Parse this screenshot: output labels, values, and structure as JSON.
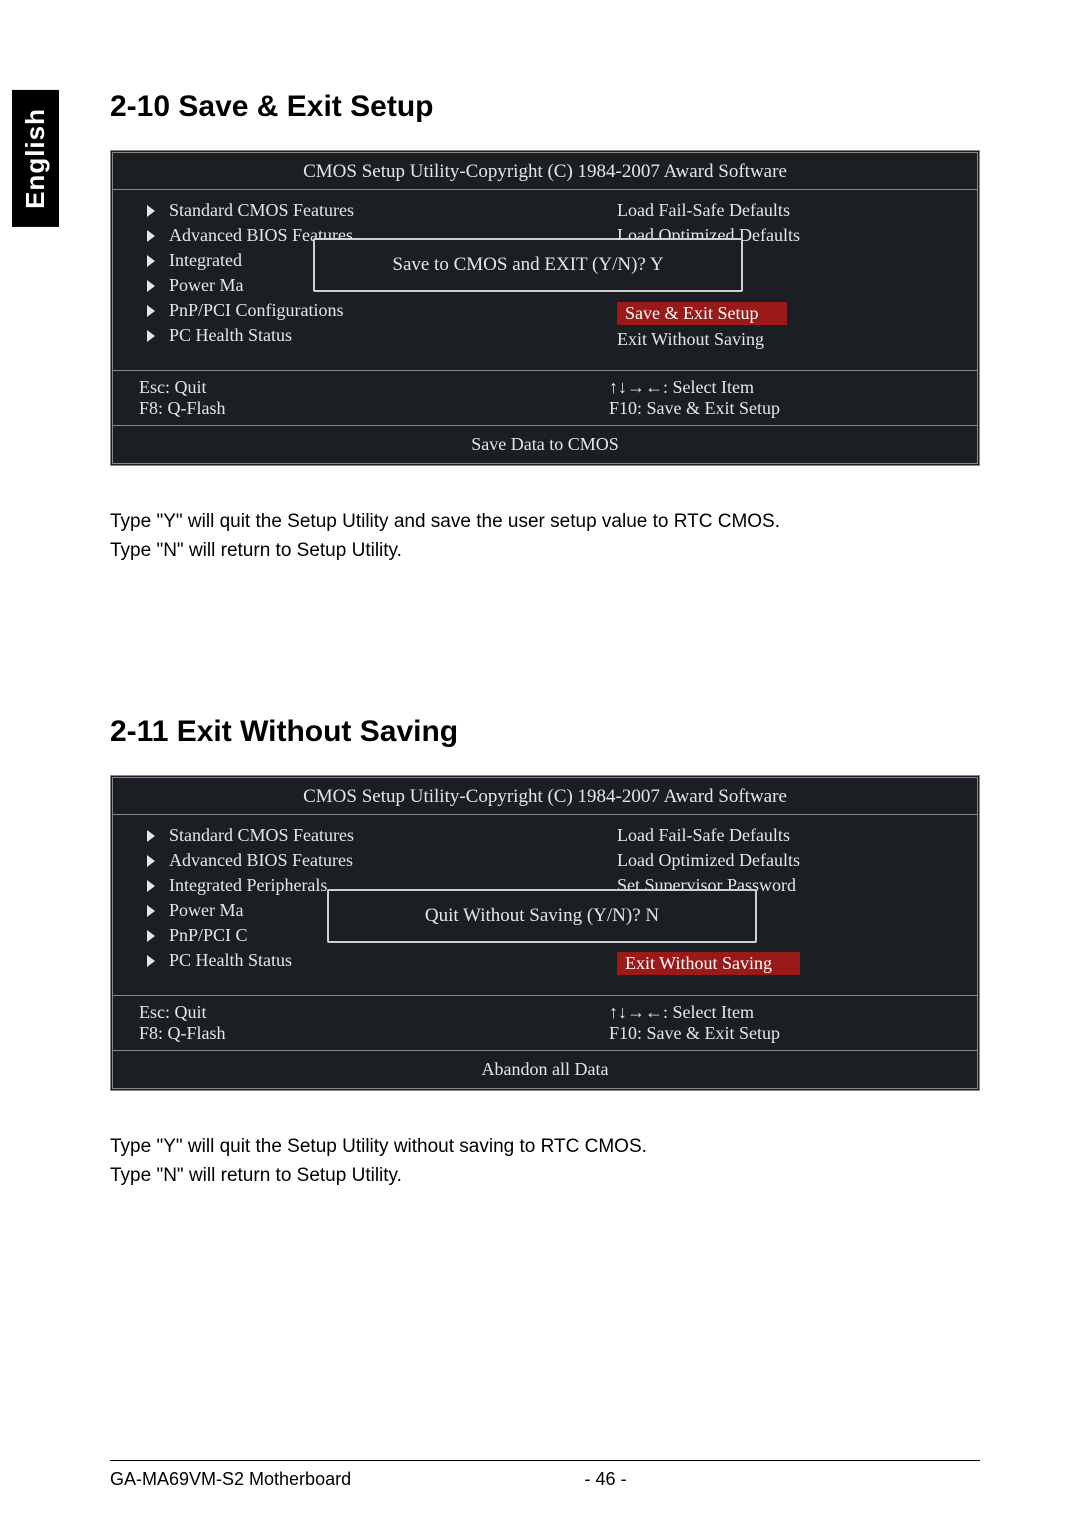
{
  "side_tab": "English",
  "section1": {
    "heading": "2-10   Save & Exit Setup",
    "bios_title": "CMOS Setup Utility-Copyright (C) 1984-2007 Award Software",
    "left_items": [
      "Standard CMOS Features",
      "Advanced BIOS Features",
      "Integrated",
      "Power Ma",
      "PnP/PCI Configurations",
      "PC Health Status"
    ],
    "right_items": [
      {
        "text": "Load Fail-Safe Defaults",
        "highlight": false
      },
      {
        "text": "Load Optimized Defaults",
        "highlight": false
      },
      {
        "text": "Save & Exit Setup",
        "highlight": true
      },
      {
        "text": "Exit Without Saving",
        "highlight": false
      }
    ],
    "dialog": "Save to CMOS and EXIT (Y/N)? Y",
    "keys": {
      "esc": "Esc: Quit",
      "select": "↑↓→←: Select Item",
      "f8": "F8: Q-Flash",
      "f10": "F10: Save & Exit Setup"
    },
    "footer": "Save Data to CMOS",
    "desc_line1": "Type \"Y\" will quit the Setup Utility and save the user setup value to RTC CMOS.",
    "desc_line2": "Type \"N\" will return to Setup Utility."
  },
  "section2": {
    "heading": "2-11   Exit Without Saving",
    "bios_title": "CMOS Setup Utility-Copyright (C) 1984-2007 Award Software",
    "left_items": [
      "Standard CMOS Features",
      "Advanced BIOS Features",
      "Integrated Peripherals",
      "Power Ma",
      "PnP/PCI C",
      "PC Health Status"
    ],
    "right_items": [
      {
        "text": "Load Fail-Safe Defaults",
        "highlight": false
      },
      {
        "text": "Load Optimized Defaults",
        "highlight": false
      },
      {
        "text": "Set Supervisor Password",
        "highlight": false
      },
      {
        "text": "Exit Without Saving",
        "highlight": true
      }
    ],
    "dialog": "Quit Without Saving (Y/N)? N",
    "keys": {
      "esc": "Esc: Quit",
      "select": "↑↓→←: Select Item",
      "f8": "F8: Q-Flash",
      "f10": "F10: Save & Exit Setup"
    },
    "footer": "Abandon all Data",
    "desc_line1": "Type \"Y\" will quit the Setup Utility without saving to RTC CMOS.",
    "desc_line2": "Type \"N\" will return to Setup Utility."
  },
  "page_footer": {
    "left": "GA-MA69VM-S2 Motherboard",
    "center": "- 46 -"
  }
}
